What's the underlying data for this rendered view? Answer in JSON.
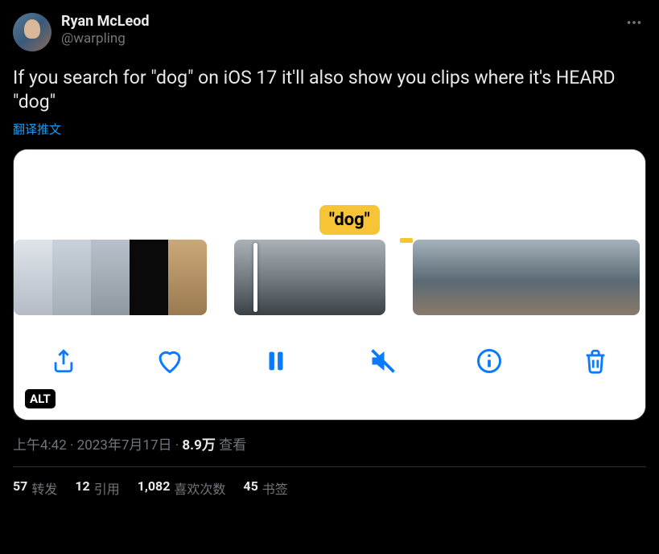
{
  "author": {
    "display_name": "Ryan McLeod",
    "handle": "@warpling"
  },
  "tweet_text": "If you search for \"dog\" on iOS 17 it'll also show you clips where it's HEARD \"dog\"",
  "translate_label": "翻译推文",
  "media": {
    "search_bubble": "\"dog\"",
    "alt_badge": "ALT",
    "toolbar": {
      "share": "share-icon",
      "like": "heart-icon",
      "pause": "pause-icon",
      "mute": "mute-icon",
      "info": "info-icon",
      "trash": "trash-icon"
    }
  },
  "meta": {
    "time": "上午4:42",
    "dot": " · ",
    "date": "2023年7月17日",
    "views_num": "8.9万",
    "views_label": " 查看"
  },
  "stats": {
    "retweets_num": "57",
    "retweets_label": "转发",
    "quotes_num": "12",
    "quotes_label": "引用",
    "likes_num": "1,082",
    "likes_label": "喜欢次数",
    "bookmarks_num": "45",
    "bookmarks_label": "书签"
  }
}
